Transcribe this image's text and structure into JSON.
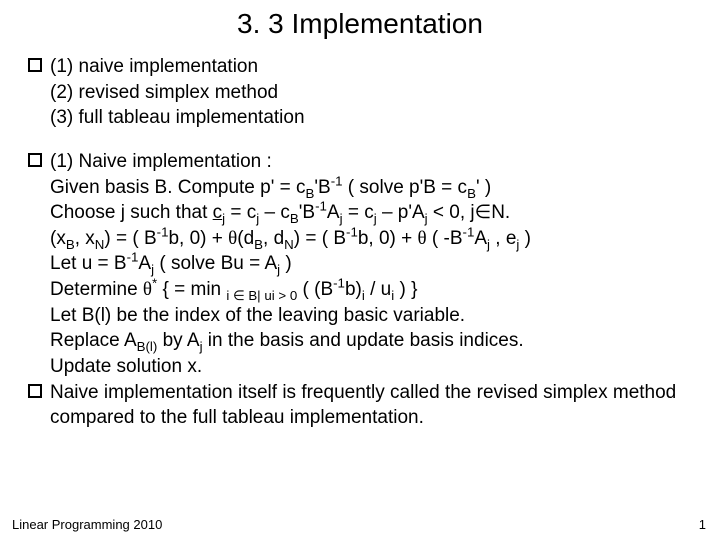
{
  "title": "3. 3 Implementation",
  "block1": {
    "l1": "(1) naive implementation",
    "l2": "(2) revised simplex method",
    "l3": "(3) full tableau implementation"
  },
  "block2": {
    "l1": "(1) Naive implementation :",
    "l2_a": "Given basis B.  Compute p' = c",
    "l2_b": "'B",
    "l2_c": "   ( solve  p'B = c",
    "l2_d": "' )",
    "l3_a": "Choose j such that  ",
    "l3_b": " = c",
    "l3_c": " – c",
    "l3_d": "'B",
    "l3_e": "A",
    "l3_f": " = c",
    "l3_g": " – p'A",
    "l3_h": " < 0,  j",
    "l3_i": "N.",
    "l4_a": "(x",
    "l4_b": ", x",
    "l4_c": ") = ( B",
    "l4_d": "b, 0) + ",
    "l4_e": "(d",
    "l4_f": ", d",
    "l4_g": ") = ( B",
    "l4_h": "b, 0) + ",
    "l4_i": " ( -B",
    "l4_j": "A",
    "l4_k": " , e",
    "l4_l": " )",
    "l5_a": "Let  u = B",
    "l5_b": "A",
    "l5_c": "    ( solve  Bu = A",
    "l5_d": " )",
    "l6_a": "Determine   ",
    "l6_b": " { = min ",
    "l6_c": "  ( (B",
    "l6_d": "b)",
    "l6_e": " / u",
    "l6_f": " ) }",
    "l7": "Let B(l) be the index of the leaving basic variable.",
    "l8_a": "Replace A",
    "l8_b": " by A",
    "l8_c": "  in the basis and update basis indices.",
    "l9": "Update solution x.",
    "l10": "Naive implementation itself is frequently called the revised simplex method compared to the full tableau implementation."
  },
  "sub": {
    "B": "B",
    "j": "j",
    "N": "N",
    "i": "i",
    "Bl": "B(l)",
    "minus1": "-1",
    "star": "*",
    "cond": "i ∈ B| ui > 0"
  },
  "sym": {
    "theta": "θ",
    "in": "∈"
  },
  "footer": "Linear Programming 2010",
  "page": "1"
}
